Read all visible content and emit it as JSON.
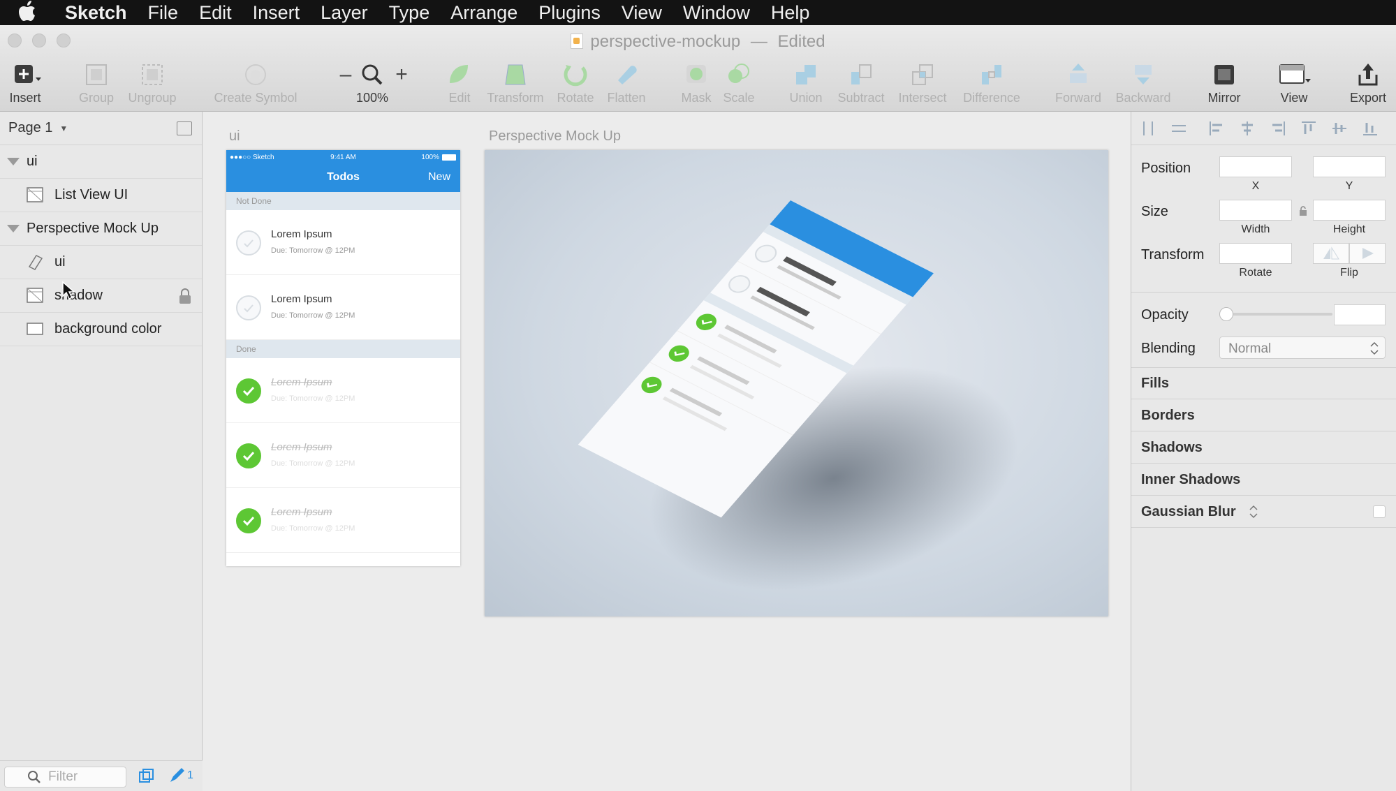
{
  "menubar": {
    "app": "Sketch",
    "items": [
      "File",
      "Edit",
      "Insert",
      "Layer",
      "Type",
      "Arrange",
      "Plugins",
      "View",
      "Window",
      "Help"
    ]
  },
  "window": {
    "title": "perspective-mockup",
    "separator": "—",
    "status": "Edited"
  },
  "toolbar": {
    "insert": "Insert",
    "group": "Group",
    "ungroup": "Ungroup",
    "create_symbol": "Create Symbol",
    "zoom_minus": "–",
    "zoom_plus": "+",
    "zoom": "100%",
    "edit": "Edit",
    "transform": "Transform",
    "rotate": "Rotate",
    "flatten": "Flatten",
    "mask": "Mask",
    "scale": "Scale",
    "union": "Union",
    "subtract": "Subtract",
    "intersect": "Intersect",
    "difference": "Difference",
    "forward": "Forward",
    "backward": "Backward",
    "mirror": "Mirror",
    "view": "View",
    "export": "Export"
  },
  "sidebar": {
    "page": "Page 1",
    "layers": [
      {
        "label": "ui",
        "kind": "group"
      },
      {
        "label": "List View UI",
        "kind": "artboard"
      },
      {
        "label": "Perspective Mock Up",
        "kind": "group"
      },
      {
        "label": "ui",
        "kind": "shape"
      },
      {
        "label": "shadow",
        "kind": "image",
        "locked": true
      },
      {
        "label": "background color",
        "kind": "rect"
      }
    ],
    "filter_placeholder": "Filter",
    "badge": "1"
  },
  "canvas": {
    "artboard1_label": "ui",
    "artboard2_label": "Perspective Mock Up",
    "phone": {
      "carrier": "●●●○○ Sketch",
      "time": "9:41 AM",
      "battery": "100%",
      "nav_title": "Todos",
      "nav_action": "New",
      "section_not_done": "Not Done",
      "section_done": "Done",
      "todos": [
        {
          "title": "Lorem Ipsum",
          "subtitle": "Due: Tomorrow @ 12PM",
          "done": false
        },
        {
          "title": "Lorem Ipsum",
          "subtitle": "Due: Tomorrow @ 12PM",
          "done": false
        },
        {
          "title": "Lorem Ipsum",
          "subtitle": "Due: Tomorrow @ 12PM",
          "done": true
        },
        {
          "title": "Lorem Ipsum",
          "subtitle": "Due: Tomorrow @ 12PM",
          "done": true
        },
        {
          "title": "Lorem Ipsum",
          "subtitle": "Due: Tomorrow @ 12PM",
          "done": true
        }
      ]
    }
  },
  "inspector": {
    "position": "Position",
    "x": "X",
    "y": "Y",
    "size": "Size",
    "width": "Width",
    "height": "Height",
    "transform": "Transform",
    "rotate": "Rotate",
    "flip": "Flip",
    "opacity": "Opacity",
    "blending": "Blending",
    "blending_value": "Normal",
    "sections": [
      "Fills",
      "Borders",
      "Shadows",
      "Inner Shadows",
      "Gaussian Blur"
    ]
  },
  "colors": {
    "accent_blue": "#2a8fe0",
    "done_green": "#5dc734"
  }
}
